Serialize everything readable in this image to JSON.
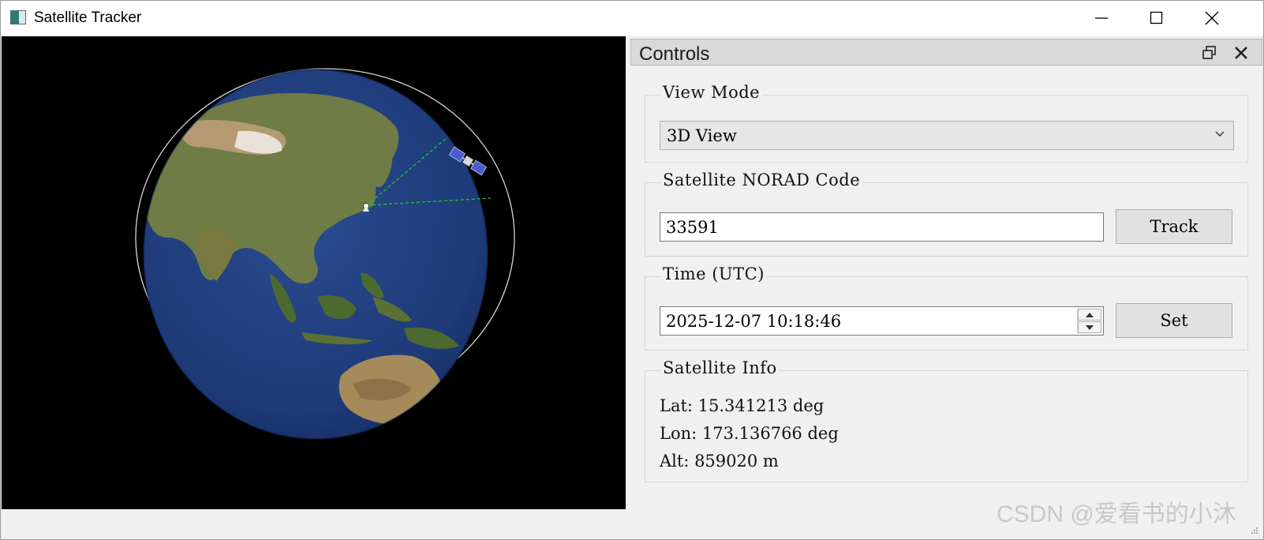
{
  "window": {
    "title": "Satellite Tracker"
  },
  "dock": {
    "title": "Controls",
    "view_mode": {
      "group_title": "View Mode",
      "selected": "3D View"
    },
    "norad": {
      "group_title": "Satellite NORAD Code",
      "value": "33591",
      "button_label": "Track"
    },
    "time": {
      "group_title": "Time (UTC)",
      "value": "2025-12-07 10:18:46",
      "button_label": "Set"
    },
    "info": {
      "group_title": "Satellite Info",
      "lat": "Lat: 15.341213 deg",
      "lon": "Lon: 173.136766 deg",
      "alt": "Alt: 859020 m"
    }
  },
  "globe": {
    "ocean_color": "#1e3a78",
    "land_color": "#6d7a45",
    "orbit_color": "#d8d8d8",
    "link_color": "#22cc22",
    "icons": [
      "satellite-icon",
      "ground-station-icon"
    ]
  },
  "watermark": "CSDN @爱看书的小沐",
  "colors": {
    "titlebar": "#ffffff",
    "panel": "#f0f0f0",
    "dock_header": "#d9d9d9"
  }
}
